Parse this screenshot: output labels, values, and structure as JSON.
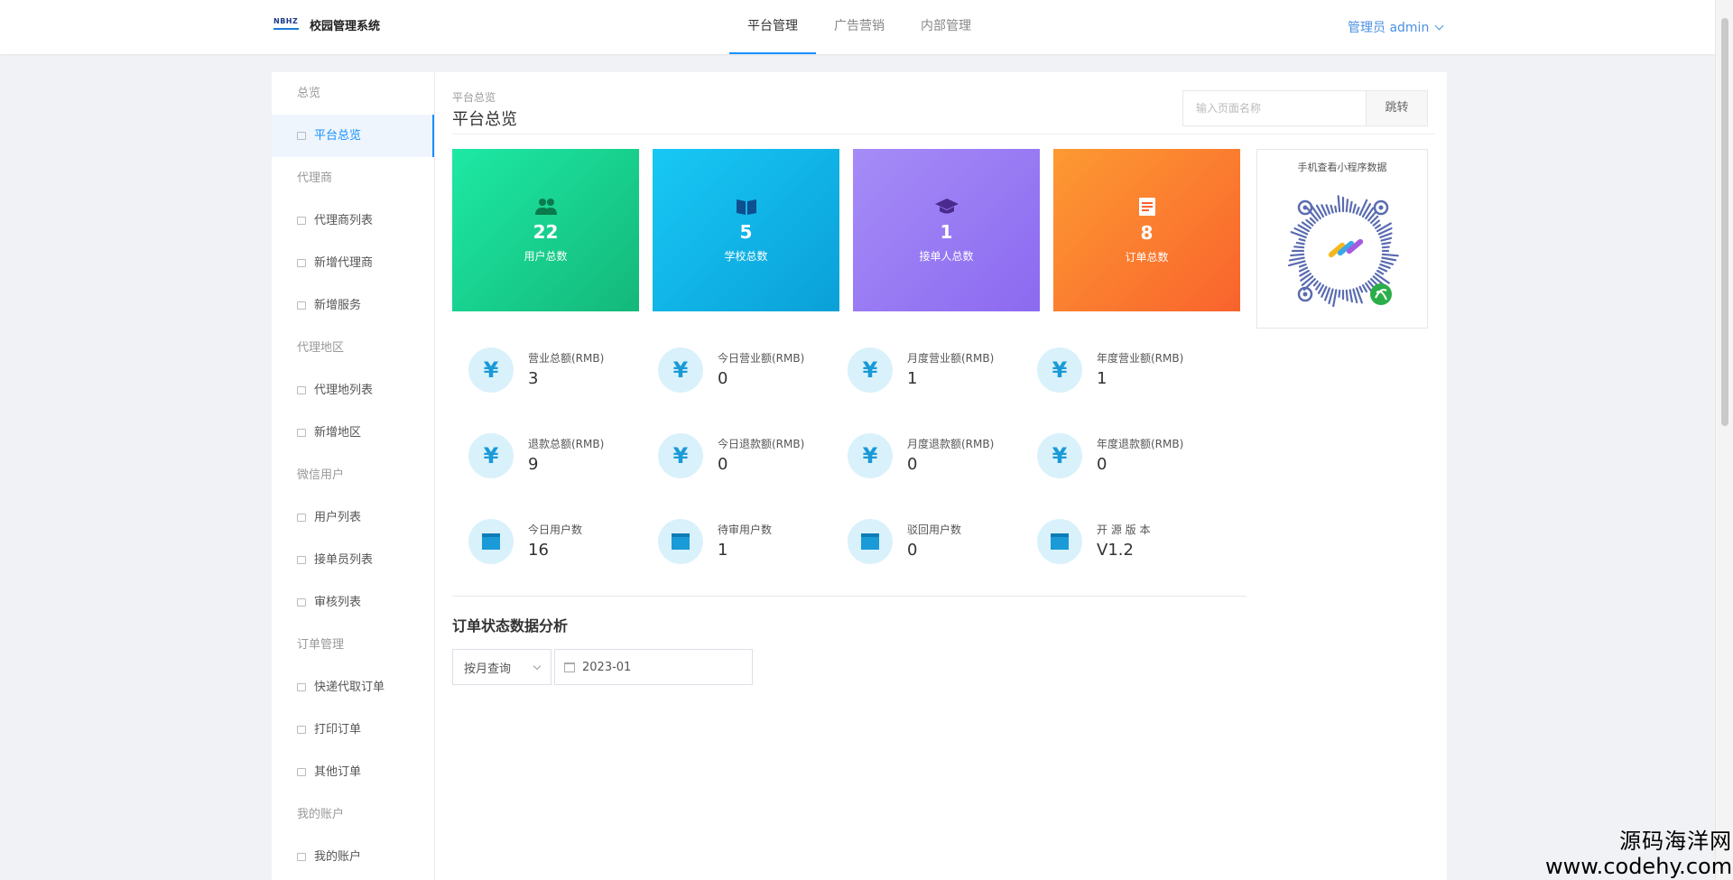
{
  "header": {
    "logo_mark": "NBHZ",
    "app_name": "校园管理系统",
    "tabs": [
      {
        "label": "平台管理",
        "active": true
      },
      {
        "label": "广告营销",
        "active": false
      },
      {
        "label": "内部管理",
        "active": false
      }
    ],
    "user_label": "管理员 admin"
  },
  "sidebar": {
    "items": [
      {
        "type": "group",
        "label": "总览"
      },
      {
        "type": "item",
        "label": "平台总览",
        "active": true
      },
      {
        "type": "group",
        "label": "代理商"
      },
      {
        "type": "item",
        "label": "代理商列表"
      },
      {
        "type": "item",
        "label": "新增代理商"
      },
      {
        "type": "item",
        "label": "新增服务"
      },
      {
        "type": "group",
        "label": "代理地区"
      },
      {
        "type": "item",
        "label": "代理地列表"
      },
      {
        "type": "item",
        "label": "新增地区"
      },
      {
        "type": "group",
        "label": "微信用户"
      },
      {
        "type": "item",
        "label": "用户列表"
      },
      {
        "type": "item",
        "label": "接单员列表"
      },
      {
        "type": "item",
        "label": "审核列表"
      },
      {
        "type": "group",
        "label": "订单管理"
      },
      {
        "type": "item",
        "label": "快递代取订单"
      },
      {
        "type": "item",
        "label": "打印订单"
      },
      {
        "type": "item",
        "label": "其他订单"
      },
      {
        "type": "group",
        "label": "我的账户"
      },
      {
        "type": "item",
        "label": "我的账户"
      }
    ]
  },
  "page": {
    "breadcrumb": "平台总览",
    "title": "平台总览",
    "jump_placeholder": "输入页面名称",
    "jump_button": "跳转"
  },
  "stat_tiles": [
    {
      "value": "22",
      "label": "用户总数",
      "icon": "users-icon",
      "color": "#14b87a"
    },
    {
      "value": "5",
      "label": "学校总数",
      "icon": "book-icon",
      "color": "#0aa0d8"
    },
    {
      "value": "1",
      "label": "接单人总数",
      "icon": "graduation-cap-icon",
      "color": "#8c6af0"
    },
    {
      "value": "8",
      "label": "订单总数",
      "icon": "document-icon",
      "color": "#f9632d"
    }
  ],
  "qr": {
    "title": "手机查看小程序数据"
  },
  "metrics": [
    [
      {
        "label": "营业总额(RMB)",
        "value": "3",
        "icon": "yen"
      },
      {
        "label": "今日营业额(RMB)",
        "value": "0",
        "icon": "yen"
      },
      {
        "label": "月度营业额(RMB)",
        "value": "1",
        "icon": "yen"
      },
      {
        "label": "年度营业额(RMB)",
        "value": "1",
        "icon": "yen"
      }
    ],
    [
      {
        "label": "退款总额(RMB)",
        "value": "9",
        "icon": "yen"
      },
      {
        "label": "今日退款额(RMB)",
        "value": "0",
        "icon": "yen"
      },
      {
        "label": "月度退款额(RMB)",
        "value": "0",
        "icon": "yen"
      },
      {
        "label": "年度退款额(RMB)",
        "value": "0",
        "icon": "yen"
      }
    ],
    [
      {
        "label": "今日用户数",
        "value": "16",
        "icon": "calendar"
      },
      {
        "label": "待审用户数",
        "value": "1",
        "icon": "calendar"
      },
      {
        "label": "驳回用户数",
        "value": "0",
        "icon": "calendar"
      },
      {
        "label": "开 源 版 本",
        "value": "V1.2",
        "icon": "calendar"
      }
    ]
  ],
  "analysis": {
    "title": "订单状态数据分析",
    "query_mode": "按月查询",
    "date": "2023-01"
  },
  "watermark": {
    "line1": "源码海洋网",
    "line2": "www.codehy.com"
  },
  "colors": {
    "accent": "#1890ff",
    "metric_icon": "#1a9ad6"
  }
}
